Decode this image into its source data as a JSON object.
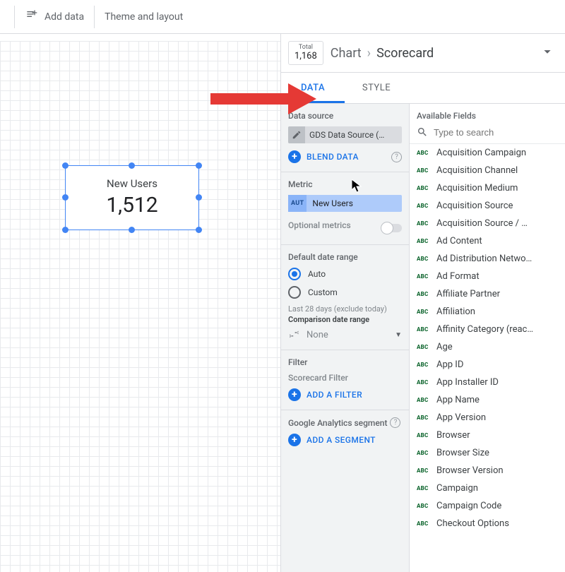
{
  "toolbar": {
    "add_data": "Add data",
    "theme_layout": "Theme and layout"
  },
  "canvas": {
    "scorecard": {
      "title": "New Users",
      "value": "1,512"
    }
  },
  "chart_header": {
    "thumb_label": "Total",
    "thumb_value": "1,168",
    "root": "Chart",
    "current": "Scorecard"
  },
  "tabs": {
    "data": "DATA",
    "style": "STYLE"
  },
  "config": {
    "data_source_title": "Data source",
    "data_source_name": "GDS Data Source (…",
    "blend_data": "BLEND DATA",
    "metric_title": "Metric",
    "metric_type": "AUT",
    "metric_name": "New Users",
    "optional_metrics": "Optional metrics",
    "date_range_title": "Default date range",
    "date_range_auto": "Auto",
    "date_range_custom": "Custom",
    "date_range_note": "Last 28 days (exclude today)",
    "comparison_title": "Comparison date range",
    "comparison_value": "None",
    "filter_title": "Filter",
    "filter_subtitle": "Scorecard Filter",
    "add_filter": "ADD A FILTER",
    "ga_segment_title": "Google Analytics segment",
    "add_segment": "ADD A SEGMENT"
  },
  "fields": {
    "title": "Available Fields",
    "search_placeholder": "Type to search",
    "badge": "ABC",
    "items": [
      "Acquisition Campaign",
      "Acquisition Channel",
      "Acquisition Medium",
      "Acquisition Source",
      "Acquisition Source / …",
      "Ad Content",
      "Ad Distribution Netwo…",
      "Ad Format",
      "Affiliate Partner",
      "Affiliation",
      "Affinity Category (reac…",
      "Age",
      "App ID",
      "App Installer ID",
      "App Name",
      "App Version",
      "Browser",
      "Browser Size",
      "Browser Version",
      "Campaign",
      "Campaign Code",
      "Checkout Options"
    ]
  }
}
